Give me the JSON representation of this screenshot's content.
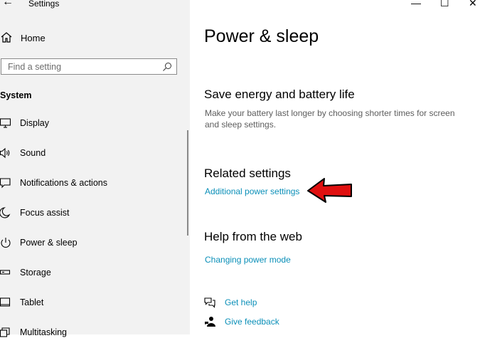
{
  "window": {
    "title": "Settings",
    "controls": {
      "minimize": "—",
      "maximize": "☐",
      "close": "✕"
    }
  },
  "sidebar": {
    "back_glyph": "←",
    "home_label": "Home",
    "search": {
      "placeholder": "Find a setting"
    },
    "section_title": "System",
    "items": [
      {
        "label": "Display",
        "icon": "display-icon"
      },
      {
        "label": "Sound",
        "icon": "sound-icon"
      },
      {
        "label": "Notifications & actions",
        "icon": "notifications-icon"
      },
      {
        "label": "Focus assist",
        "icon": "focus-assist-icon"
      },
      {
        "label": "Power & sleep",
        "icon": "power-icon"
      },
      {
        "label": "Storage",
        "icon": "storage-icon"
      },
      {
        "label": "Tablet",
        "icon": "tablet-icon"
      },
      {
        "label": "Multitasking",
        "icon": "multitasking-icon"
      }
    ]
  },
  "main": {
    "page_title": "Power & sleep",
    "save_energy": {
      "heading": "Save energy and battery life",
      "description": "Make your battery last longer by choosing shorter times for screen and sleep settings."
    },
    "related": {
      "heading": "Related settings",
      "link": "Additional power settings"
    },
    "help": {
      "heading": "Help from the web",
      "link": "Changing power mode"
    },
    "support": {
      "get_help": "Get help",
      "give_feedback": "Give feedback"
    }
  },
  "colors": {
    "link": "#0a8fb8",
    "sidebar_bg": "#f2f2f2",
    "annotation_arrow": "#e01010"
  }
}
